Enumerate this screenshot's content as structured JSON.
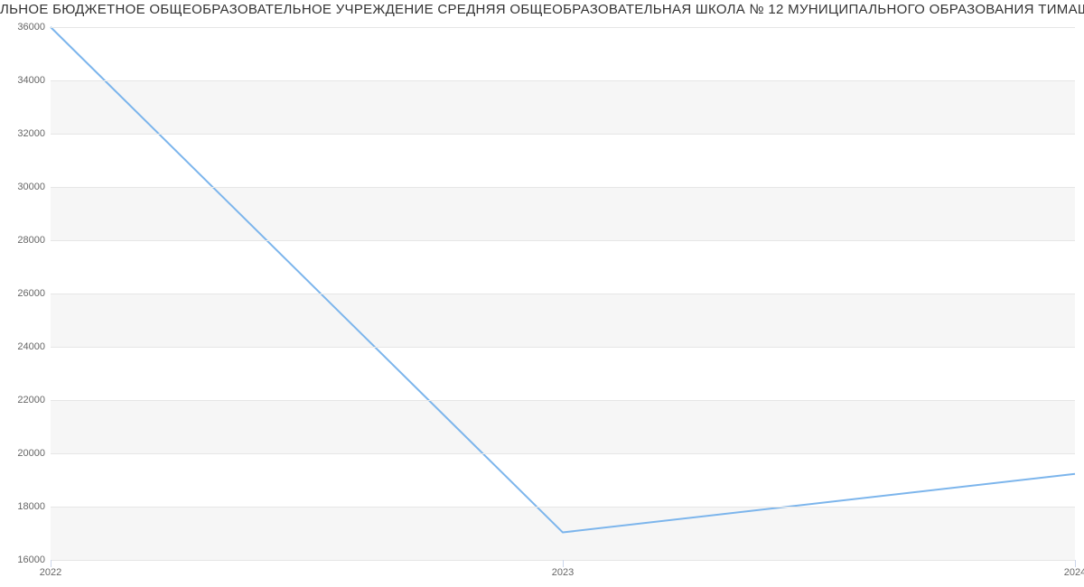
{
  "chart_data": {
    "type": "line",
    "title": "ЛЬНОЕ БЮДЖЕТНОЕ ОБЩЕОБРАЗОВАТЕЛЬНОЕ УЧРЕЖДЕНИЕ СРЕДНЯЯ ОБЩЕОБРАЗОВАТЕЛЬНАЯ ШКОЛА № 12 МУНИЦИПАЛЬНОГО ОБРАЗОВАНИЯ ТИМАШЕВСКИЙ РАЙО",
    "x": [
      2022,
      2023,
      2024
    ],
    "values": [
      36000,
      17000,
      19200
    ],
    "xlim": [
      2022,
      2024
    ],
    "ylim": [
      16000,
      36000
    ],
    "y_ticks": [
      16000,
      18000,
      20000,
      22000,
      24000,
      26000,
      28000,
      30000,
      32000,
      34000,
      36000
    ],
    "x_ticks": [
      2022,
      2023,
      2024
    ],
    "line_color": "#7cb5ec"
  }
}
